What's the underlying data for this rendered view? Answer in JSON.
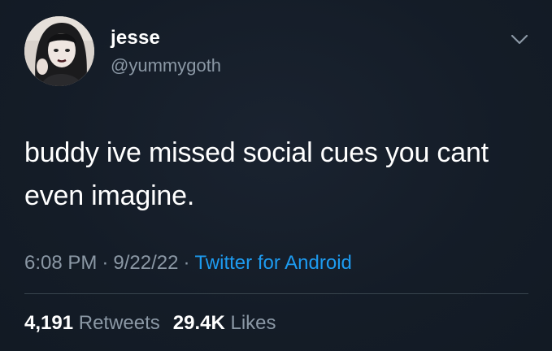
{
  "user": {
    "name": "jesse",
    "handle": "@yummygoth",
    "avatar_icon": "profile-photo"
  },
  "tweet": {
    "text": "buddy ive missed social cues you cant even imagine."
  },
  "meta": {
    "time": "6:08 PM",
    "separator": "·",
    "date": "9/22/22",
    "source": "Twitter for Android"
  },
  "stats": {
    "retweets_count": "4,191",
    "retweets_label": "Retweets",
    "likes_count": "29.4K",
    "likes_label": "Likes"
  },
  "icons": {
    "menu": "chevron-down-icon"
  },
  "colors": {
    "background": "#15202b",
    "text_primary": "#ffffff",
    "text_secondary": "#8b98a5",
    "link": "#1d9bf0",
    "divider": "#38444d"
  }
}
